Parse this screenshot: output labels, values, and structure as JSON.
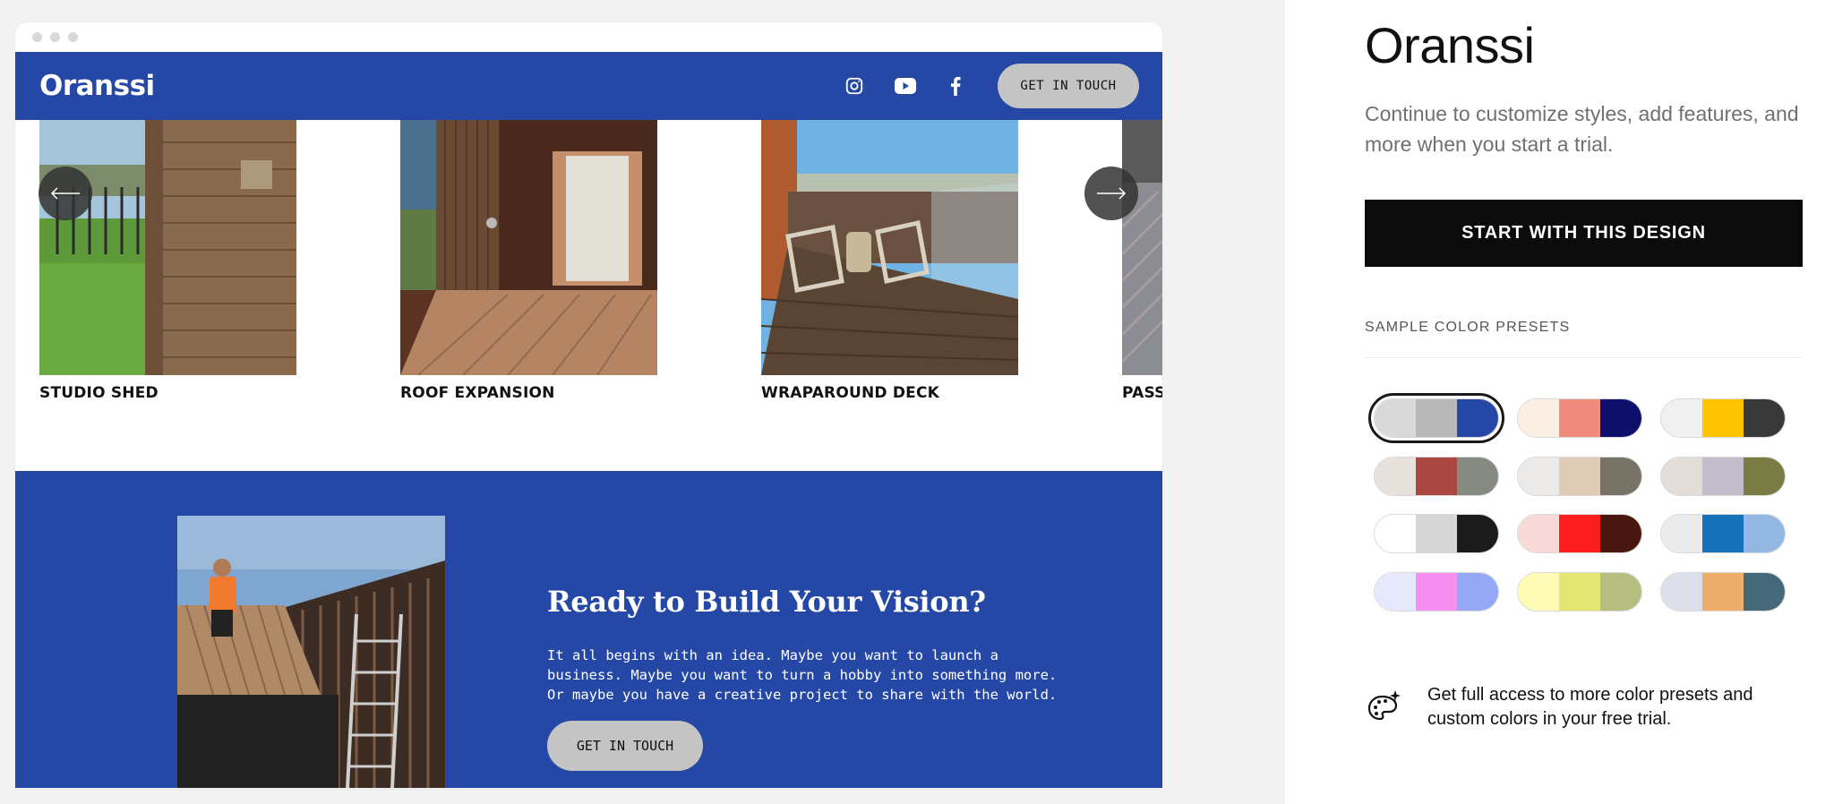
{
  "preview": {
    "site": {
      "logo": "Oranssi",
      "social_icons": [
        "instagram-icon",
        "youtube-icon",
        "facebook-icon"
      ],
      "header_button": "GET IN TOUCH"
    },
    "gallery": {
      "items": [
        {
          "caption": "STUDIO SHED"
        },
        {
          "caption": "ROOF EXPANSION"
        },
        {
          "caption": "WRAPAROUND DECK"
        },
        {
          "caption": "PASS"
        }
      ],
      "prev_icon": "arrow-left-icon",
      "next_icon": "arrow-right-icon"
    },
    "cta": {
      "title": "Ready to Build Your Vision?",
      "body_line1": "It all begins with an idea. Maybe you want to launch a",
      "body_line2": "business. Maybe you want to turn a hobby into something more.",
      "body_line3": "Or maybe you have a creative project to share with the world.",
      "button": "GET IN TOUCH"
    },
    "colors": {
      "accent": "#2547a6",
      "button_gray": "#c4c4c4"
    }
  },
  "panel": {
    "title": "Oranssi",
    "description": "Continue to customize styles, add features, and more when you start a trial.",
    "start_button": "START WITH THIS DESIGN",
    "presets_label": "SAMPLE COLOR PRESETS",
    "presets": [
      {
        "colors": [
          "#d9d9d9",
          "#b8b8b8",
          "#2547a6"
        ],
        "selected": true
      },
      {
        "colors": [
          "#fbeee3",
          "#f08c7e",
          "#0e0e6b"
        ],
        "selected": false
      },
      {
        "colors": [
          "#f0f0f0",
          "#ffc400",
          "#383838"
        ],
        "selected": false
      },
      {
        "colors": [
          "#e6e1dc",
          "#a8463f",
          "#858b80"
        ],
        "selected": false
      },
      {
        "colors": [
          "#ebeae8",
          "#e0cbb9",
          "#767265"
        ],
        "selected": false
      },
      {
        "colors": [
          "#e2ddd8",
          "#c1bdca",
          "#7a7a44"
        ],
        "selected": false
      },
      {
        "colors": [
          "#ffffff",
          "#d6d6d6",
          "#1b1b1b"
        ],
        "selected": false
      },
      {
        "colors": [
          "#f7d9d8",
          "#ff1e1e",
          "#4a1610"
        ],
        "selected": false
      },
      {
        "colors": [
          "#ebebeb",
          "#1571b8",
          "#92b7e2"
        ],
        "selected": false
      },
      {
        "colors": [
          "#e5e9fb",
          "#f58ff2",
          "#95a8f6"
        ],
        "selected": false
      },
      {
        "colors": [
          "#fdfbb5",
          "#e2e673",
          "#b5bd7f"
        ],
        "selected": false
      },
      {
        "colors": [
          "#dcdfea",
          "#ecae6a",
          "#466a7a"
        ],
        "selected": false
      }
    ],
    "upsell_icon": "palette-sparkle-icon",
    "upsell_text": "Get full access to more color presets and custom colors in your free trial."
  }
}
